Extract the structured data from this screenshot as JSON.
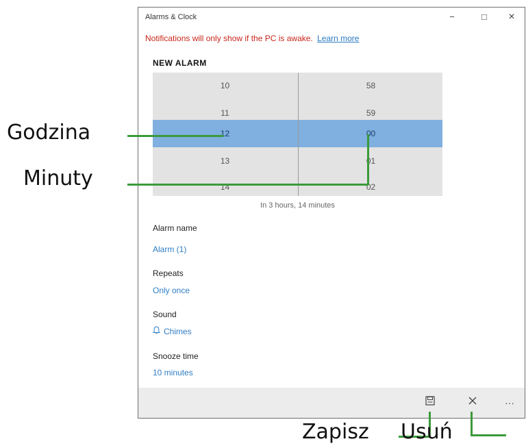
{
  "window": {
    "title": "Alarms & Clock",
    "controls": {
      "minimize": "−",
      "maximize": "□",
      "close": "×"
    }
  },
  "notification": {
    "text": "Notifications will only show if the PC is awake.",
    "link": "Learn more"
  },
  "new_alarm": {
    "heading": "NEW ALARM",
    "hours": [
      "10",
      "11",
      "12",
      "13",
      "14"
    ],
    "minutes": [
      "58",
      "59",
      "00",
      "01",
      "02"
    ],
    "selected_hour": "12",
    "selected_minute": "00",
    "remaining": "In 3 hours, 14 minutes",
    "selection_color": "#7fb0df"
  },
  "fields": {
    "alarm_name": {
      "label": "Alarm name",
      "value": "Alarm (1)"
    },
    "repeats": {
      "label": "Repeats",
      "value": "Only once"
    },
    "sound": {
      "label": "Sound",
      "value": "Chimes",
      "icon": "bell-icon"
    },
    "snooze": {
      "label": "Snooze time",
      "value": "10 minutes"
    }
  },
  "command_bar": {
    "save_icon": "save-icon",
    "delete_icon": "close-icon",
    "more": "···"
  },
  "annotations": {
    "hour": "Godzina",
    "minutes": "Minuty",
    "save": "Zapisz",
    "delete": "Usuń",
    "line_color": "#3b9a3b"
  }
}
